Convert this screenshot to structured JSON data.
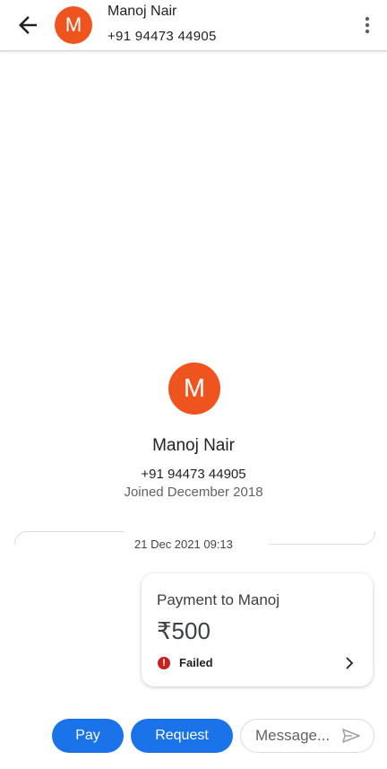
{
  "header": {
    "contact_initial": "M",
    "contact_name": "Manoj Nair",
    "contact_phone": "+91 94473 44905"
  },
  "profile": {
    "initial": "M",
    "name": "Manoj Nair",
    "phone": "+91 94473 44905",
    "joined": "Joined December 2018"
  },
  "conversation": {
    "date_separator": "21 Dec 2021 09:13",
    "payment_card": {
      "title": "Payment to Manoj",
      "amount": "₹500",
      "status": "Failed"
    }
  },
  "composer": {
    "pay_label": "Pay",
    "request_label": "Request",
    "message_placeholder": "Message..."
  },
  "colors": {
    "avatar": "#f0541e",
    "primary": "#1a73e8",
    "error": "#c5221f"
  },
  "icons": [
    "arrow-back-icon",
    "more-vert-icon",
    "error-icon",
    "chevron-right-icon",
    "send-icon"
  ]
}
